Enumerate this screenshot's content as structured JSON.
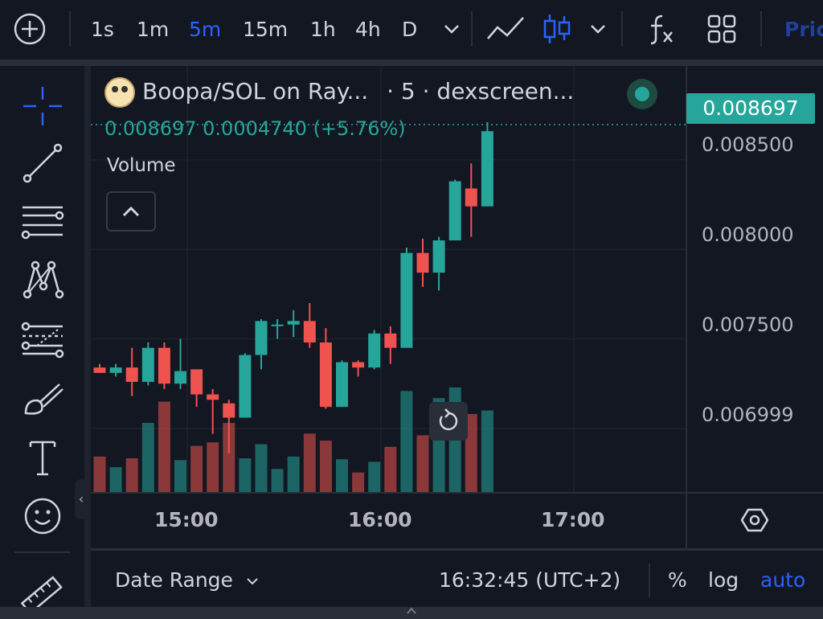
{
  "toolbar": {
    "intervals": [
      "1s",
      "1m",
      "5m",
      "15m",
      "1h",
      "4h",
      "D"
    ],
    "active_interval": "5m",
    "price_tab_partial": "Pric",
    "icons": [
      "add-symbol-icon",
      "chevron-down-icon",
      "line-chart-icon",
      "candles-icon",
      "chevron-down-icon",
      "indicators-icon",
      "layout-grid-icon"
    ]
  },
  "sidebar": {
    "tools": [
      "crosshair-icon",
      "trend-line-icon",
      "horizontal-lines-icon",
      "pattern-icon",
      "fib-levels-icon",
      "brush-icon",
      "text-icon",
      "emoji-icon",
      "ruler-icon"
    ]
  },
  "legend": {
    "title": "Boopa/SOL on Ray...",
    "subtitle": "· 5 · dexscreen...",
    "ohlc_text": "0.008697  0.0004740 (+5.76%)",
    "volume_label": "Volume"
  },
  "price_axis": {
    "last_price": "0.008697",
    "labels": [
      "0.008500",
      "0.008000",
      "0.007500",
      "0.006999"
    ]
  },
  "time_axis": {
    "labels": [
      "15:00",
      "16:00",
      "17:00"
    ]
  },
  "bottom_bar": {
    "date_range": "Date Range",
    "clock": "16:32:45 (UTC+2)",
    "percent": "%",
    "log": "log",
    "auto": "auto"
  },
  "colors": {
    "up": "#26a69a",
    "down": "#ef5350",
    "accent": "#2962ff",
    "background": "#131722"
  },
  "chart_data": {
    "type": "candlestick",
    "interval": "5m",
    "y_range": [
      0.0066,
      0.0088
    ],
    "x_ticks": [
      "15:00",
      "16:00",
      "17:00"
    ],
    "candles": [
      {
        "o": 0.00734,
        "h": 0.00736,
        "l": 0.00731,
        "c": 0.00731,
        "vol": 200
      },
      {
        "o": 0.00731,
        "h": 0.00736,
        "l": 0.00729,
        "c": 0.00734,
        "vol": 140
      },
      {
        "o": 0.00734,
        "h": 0.00745,
        "l": 0.00718,
        "c": 0.00726,
        "vol": 190
      },
      {
        "o": 0.00726,
        "h": 0.00748,
        "l": 0.00724,
        "c": 0.00745,
        "vol": 390
      },
      {
        "o": 0.00745,
        "h": 0.00748,
        "l": 0.00722,
        "c": 0.00725,
        "vol": 510
      },
      {
        "o": 0.00725,
        "h": 0.0075,
        "l": 0.00722,
        "c": 0.00732,
        "vol": 180
      },
      {
        "o": 0.00733,
        "h": 0.00733,
        "l": 0.00712,
        "c": 0.00719,
        "vol": 260
      },
      {
        "o": 0.00719,
        "h": 0.00722,
        "l": 0.00697,
        "c": 0.00716,
        "vol": 280
      },
      {
        "o": 0.00714,
        "h": 0.00716,
        "l": 0.00686,
        "c": 0.00706,
        "vol": 390
      },
      {
        "o": 0.00706,
        "h": 0.00742,
        "l": 0.00706,
        "c": 0.00741,
        "vol": 190
      },
      {
        "o": 0.00741,
        "h": 0.00761,
        "l": 0.00733,
        "c": 0.0076,
        "vol": 270
      },
      {
        "o": 0.00758,
        "h": 0.00761,
        "l": 0.0075,
        "c": 0.00758,
        "vol": 130
      },
      {
        "o": 0.00758,
        "h": 0.00766,
        "l": 0.00751,
        "c": 0.0076,
        "vol": 200
      },
      {
        "o": 0.0076,
        "h": 0.0077,
        "l": 0.00745,
        "c": 0.00748,
        "vol": 330
      },
      {
        "o": 0.00748,
        "h": 0.00756,
        "l": 0.00711,
        "c": 0.00712,
        "vol": 290
      },
      {
        "o": 0.00712,
        "h": 0.00738,
        "l": 0.00712,
        "c": 0.00737,
        "vol": 185
      },
      {
        "o": 0.00737,
        "h": 0.00738,
        "l": 0.00729,
        "c": 0.00734,
        "vol": 110
      },
      {
        "o": 0.00734,
        "h": 0.00755,
        "l": 0.00733,
        "c": 0.00753,
        "vol": 170
      },
      {
        "o": 0.00753,
        "h": 0.00757,
        "l": 0.00736,
        "c": 0.00745,
        "vol": 255
      },
      {
        "o": 0.00745,
        "h": 0.00801,
        "l": 0.00745,
        "c": 0.00798,
        "vol": 570
      },
      {
        "o": 0.00798,
        "h": 0.00806,
        "l": 0.00779,
        "c": 0.00787,
        "vol": 320
      },
      {
        "o": 0.00787,
        "h": 0.00807,
        "l": 0.00777,
        "c": 0.00805,
        "vol": 530
      },
      {
        "o": 0.00805,
        "h": 0.00839,
        "l": 0.00805,
        "c": 0.00838,
        "vol": 590
      },
      {
        "o": 0.00834,
        "h": 0.00848,
        "l": 0.00807,
        "c": 0.00824,
        "vol": 440
      },
      {
        "o": 0.00824,
        "h": 0.00871,
        "l": 0.00824,
        "c": 0.00866,
        "vol": 460
      }
    ]
  }
}
